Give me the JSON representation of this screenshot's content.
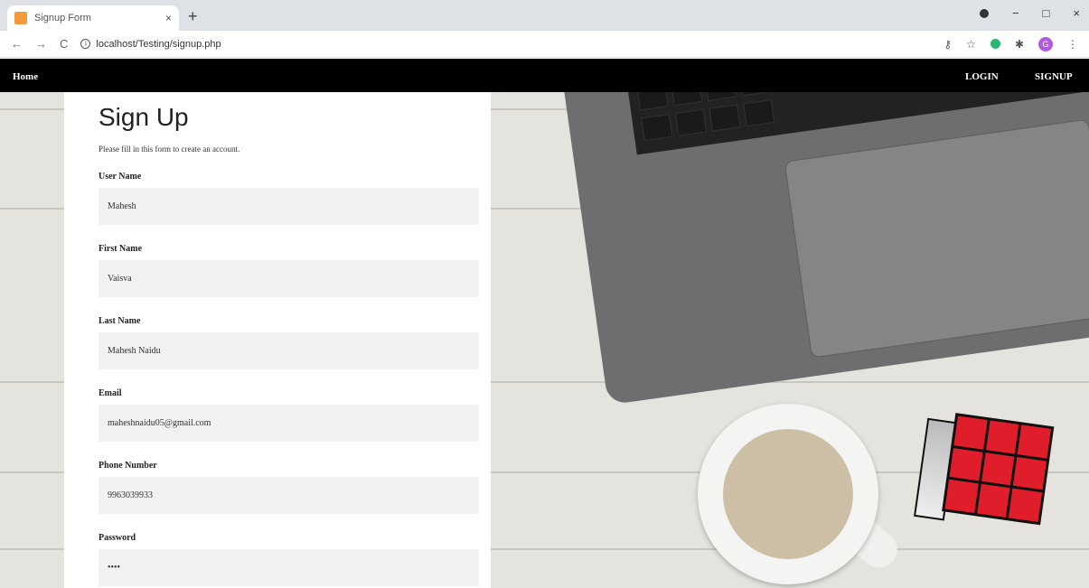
{
  "browser": {
    "tab_title": "Signup Form",
    "tab_close": "×",
    "new_tab": "+",
    "url": "localhost/Testing/signup.php",
    "back": "←",
    "forward": "→",
    "reload": "C",
    "controls": {
      "minimize": "−",
      "maximize": "□",
      "close": "×"
    },
    "avatar_letter": "G"
  },
  "nav": {
    "home": "Home",
    "login": "LOGIN",
    "signup": "SIGNUP"
  },
  "form": {
    "title": "Sign Up",
    "description": "Please fill in this form to create an account.",
    "fields": [
      {
        "label": "User Name",
        "value": "Mahesh"
      },
      {
        "label": "First Name",
        "value": "Vaisva"
      },
      {
        "label": "Last Name",
        "value": "Mahesh Naidu"
      },
      {
        "label": "Email",
        "value": "maheshnaidu05@gmail.com"
      },
      {
        "label": "Phone Number",
        "value": "9963039933"
      },
      {
        "label": "Password",
        "value": "••••"
      }
    ]
  },
  "colors": {
    "nav_bg": "#000000",
    "input_bg": "#f1f1f1",
    "cube_red": "#e01e2b"
  }
}
